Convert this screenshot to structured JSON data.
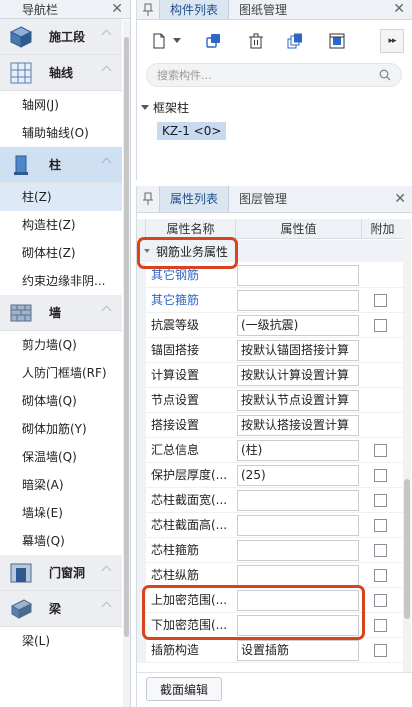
{
  "nav": {
    "title": "导航栏",
    "categories": [
      {
        "label": "施工段",
        "items": []
      },
      {
        "label": "轴线",
        "items": [
          "轴网(J)",
          "辅助轴线(O)"
        ]
      },
      {
        "label": "柱",
        "items": [
          "柱(Z)",
          "构造柱(Z)",
          "砌体柱(Z)",
          "约束边缘非阴..."
        ]
      },
      {
        "label": "墙",
        "items": [
          "剪力墙(Q)",
          "人防门框墙(RF)",
          "砌体墙(Q)",
          "砌体加筋(Y)",
          "保温墙(Q)",
          "暗梁(A)",
          "墙垛(E)",
          "幕墙(Q)"
        ]
      },
      {
        "label": "门窗洞",
        "items": []
      },
      {
        "label": "梁",
        "items": [
          "梁(L)"
        ]
      }
    ]
  },
  "component_panel": {
    "tabs": [
      "构件列表",
      "图纸管理"
    ],
    "active_tab": "构件列表",
    "search": {
      "placeholder": "搜索构件...",
      "value": ""
    },
    "tree": {
      "root": "框架柱",
      "leaf": "KZ-1 <0>"
    }
  },
  "property_panel": {
    "tabs": [
      "属性列表",
      "图层管理"
    ],
    "active_tab": "属性列表",
    "columns": [
      "属性名称",
      "属性值",
      "附加"
    ],
    "group": "钢筋业务属性",
    "rows": [
      {
        "name": "其它钢筋",
        "value": "",
        "checkbox": false,
        "blue": true
      },
      {
        "name": "其它箍筋",
        "value": "",
        "checkbox": true,
        "blue": true
      },
      {
        "name": "抗震等级",
        "value": "(一级抗震)",
        "checkbox": true
      },
      {
        "name": "锚固搭接",
        "value": "按默认锚固搭接计算",
        "checkbox": false
      },
      {
        "name": "计算设置",
        "value": "按默认计算设置计算",
        "checkbox": false
      },
      {
        "name": "节点设置",
        "value": "按默认节点设置计算",
        "checkbox": false
      },
      {
        "name": "搭接设置",
        "value": "按默认搭接设置计算",
        "checkbox": false
      },
      {
        "name": "汇总信息",
        "value": "(柱)",
        "checkbox": true
      },
      {
        "name": "保护层厚度(...",
        "value": "(25)",
        "checkbox": true
      },
      {
        "name": "芯柱截面宽(...",
        "value": "",
        "checkbox": true
      },
      {
        "name": "芯柱截面高(...",
        "value": "",
        "checkbox": true
      },
      {
        "name": "芯柱箍筋",
        "value": "",
        "checkbox": true
      },
      {
        "name": "芯柱纵筋",
        "value": "",
        "checkbox": true
      },
      {
        "name": "上加密范围(...",
        "value": "",
        "checkbox": true
      },
      {
        "name": "下加密范围(...",
        "value": "",
        "checkbox": true
      },
      {
        "name": "插筋构造",
        "value": "设置插筋",
        "checkbox": true
      }
    ],
    "footer_button": "截面编辑"
  },
  "colors": {
    "highlight": "#d9431e",
    "link_blue": "#2e66c7",
    "active_tab_text": "#1f4e8c"
  }
}
